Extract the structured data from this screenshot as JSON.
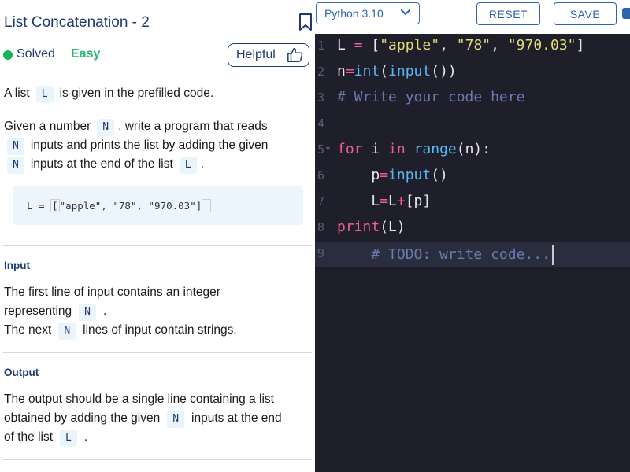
{
  "problem": {
    "title": "List Concatenation - 2",
    "status": "Solved",
    "difficulty": "Easy",
    "helpful_label": "Helpful"
  },
  "description": {
    "p1_a": "A list",
    "p1_chip": "L",
    "p1_b": "is given in the prefilled code.",
    "p2_a": "Given a number",
    "p2_chip1": "N",
    "p2_b": ", write a program that reads",
    "p2_chip2": "N",
    "p2_c": "inputs and prints the list by adding the given",
    "p2_chip3": "N",
    "p2_d": "inputs at the end of the list",
    "p2_chip4": "L",
    "p2_e": ".",
    "code_sample_a": "L = ",
    "code_sample_b": "[",
    "code_sample_c": "\"apple\", \"78\", \"970.03\"",
    "code_sample_d": "]"
  },
  "input_section": {
    "heading": "Input",
    "l1": "The first line of input contains an integer",
    "l2a": "representing",
    "l2_chip": "N",
    "l2b": ".",
    "l3a": "The next",
    "l3_chip": "N",
    "l3b": "lines of input contain strings."
  },
  "output_section": {
    "heading": "Output",
    "l1": "The output should be a single line containing a list",
    "l2a": "obtained by adding the given",
    "l2_chip": "N",
    "l2b": "inputs at the end",
    "l3a": "of the list",
    "l3_chip": "L",
    "l3b": "."
  },
  "toolbar": {
    "language": "Python 3.10",
    "reset_label": "RESET",
    "save_label": "SAVE"
  },
  "editor": {
    "line_numbers": [
      "1",
      "2",
      "3",
      "4",
      "5",
      "6",
      "7",
      "8",
      "9"
    ],
    "l1": {
      "a": "L ",
      "b": "=",
      "c": " [",
      "d": "\"apple\"",
      "e": ", ",
      "f": "\"78\"",
      "g": ", ",
      "h": "\"970.03\"",
      "i": "]"
    },
    "l2": {
      "a": "n",
      "b": "=",
      "c": "int",
      "d": "(",
      "e": "input",
      "f": "())"
    },
    "l3": {
      "a": "# Write your code here"
    },
    "l5": {
      "a": "for",
      "b": " i ",
      "c": "in",
      "d": " ",
      "e": "range",
      "f": "(n):"
    },
    "l6": {
      "a": "    p",
      "b": "=",
      "c": "input",
      "d": "()"
    },
    "l7": {
      "a": "    L",
      "b": "=",
      "c": "L",
      "d": "+",
      "e": "[p]"
    },
    "l8": {
      "a": "print",
      "b": "(L)"
    },
    "l9": {
      "a": "    # TODO: write code..."
    }
  },
  "colors": {
    "accent": "#2c64b0",
    "title": "#1e3a6e",
    "solved": "#16b25c",
    "editor_bg": "#1e1f2b"
  }
}
